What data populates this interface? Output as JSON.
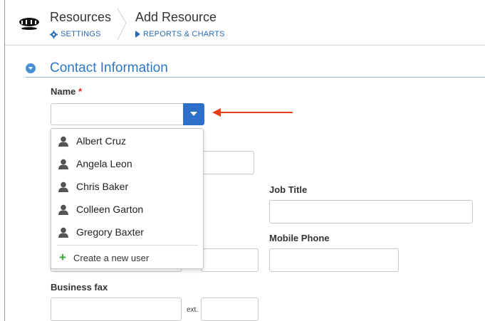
{
  "header": {
    "breadcrumb_parent": "Resources",
    "breadcrumb_current": "Add Resource",
    "settings_link": "SETTINGS",
    "reports_link": "REPORTS & CHARTS"
  },
  "section": {
    "title": "Contact Information"
  },
  "form": {
    "name_label": "Name",
    "required_mark": "*",
    "name_value": "",
    "job_title_label": "Job Title",
    "mobile_phone_label": "Mobile Phone",
    "business_fax_label": "Business fax",
    "ext_label": "ext."
  },
  "dropdown": {
    "users": [
      "Albert Cruz",
      "Angela Leon",
      "Chris Baker",
      "Colleen Garton",
      "Gregory Baxter"
    ],
    "create_label": "Create a new user"
  },
  "colors": {
    "accent": "#2f6fc9",
    "section_title": "#2d78c6",
    "annotation_arrow": "#e8401c",
    "create_plus": "#3aa53a"
  }
}
